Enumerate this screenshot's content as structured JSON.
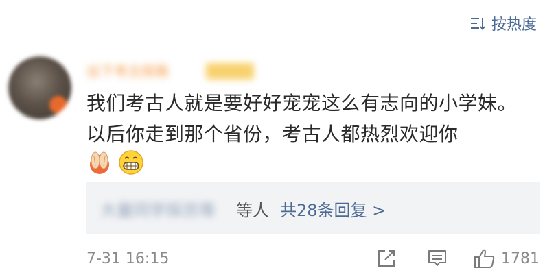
{
  "sort": {
    "label": "按热度",
    "icon": "sort-icon"
  },
  "comment": {
    "username": "出下考古探路",
    "text": "我们考古人就是要好好宠宠这么有志向的小学妹。以后你走到那个省份，考古人都热烈欢迎你",
    "emojis": [
      "clapping-hands-icon",
      "grinning-face-icon"
    ]
  },
  "replies": {
    "names": "大量同学探员等",
    "suffix": "等人",
    "count_label": "共28条回复 >"
  },
  "footer": {
    "time": "7-31 16:15",
    "likes": "1781",
    "share_icon": "share-icon",
    "comment_icon": "comment-icon",
    "like_icon": "thumbs-up-icon"
  },
  "colors": {
    "link": "#4c6b94",
    "reply_bg": "#f2f3f5",
    "meta": "#8a8a8a"
  }
}
